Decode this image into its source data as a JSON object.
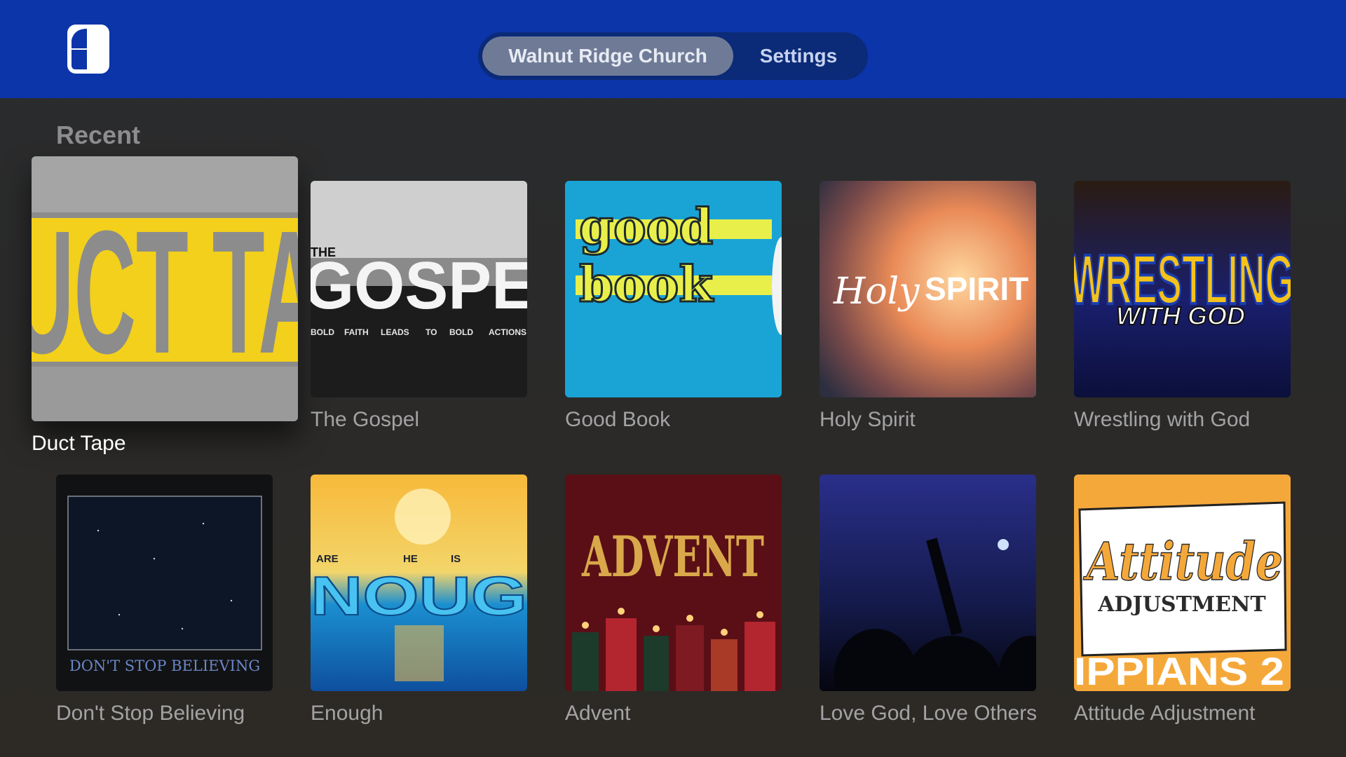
{
  "header": {
    "tabs": [
      {
        "label": "Walnut Ridge Church",
        "active": true
      },
      {
        "label": "Settings",
        "active": false
      }
    ]
  },
  "section": {
    "title": "Recent"
  },
  "items": [
    {
      "title": "Duct Tape",
      "focused": true
    },
    {
      "title": "The Gospel"
    },
    {
      "title": "Good Book"
    },
    {
      "title": "Holy Spirit"
    },
    {
      "title": "Wrestling with God"
    },
    {
      "title": "Don't Stop Believing"
    },
    {
      "title": "Enough"
    },
    {
      "title": "Advent"
    },
    {
      "title": "Love God, Love Others"
    },
    {
      "title": "Attitude Adjustment"
    }
  ],
  "artwork_text": {
    "duct_tape": "UCT TA",
    "gospel_the": "THE",
    "gospel_word": "GOSPE",
    "gospel_tagline": [
      "BOLD",
      "FAITH",
      "LEADS",
      "TO",
      "BOLD",
      "ACTIONS"
    ],
    "good_book": [
      "good",
      "book"
    ],
    "holy_spirit": [
      "Holy",
      "SPIRIT"
    ],
    "wrestling": [
      "WRESTLING",
      "WITH GOD"
    ],
    "dont_stop": "DON'T STOP BELIEVING",
    "enough_top": [
      "ARE",
      "HE",
      "IS"
    ],
    "enough_word": "NOUG",
    "advent": "ADVENT",
    "attitude": [
      "Attitude",
      "ADJUSTMENT",
      "IPPIANS 2"
    ]
  },
  "colors": {
    "header_bg": "#0b35a8",
    "tab_active_bg": "#6f7b96",
    "duct_yellow": "#f2d01c",
    "good_book_blue": "#1aa4d6",
    "attitude_orange": "#f5a83a"
  },
  "icons": {
    "logo": "app-logo-icon"
  }
}
